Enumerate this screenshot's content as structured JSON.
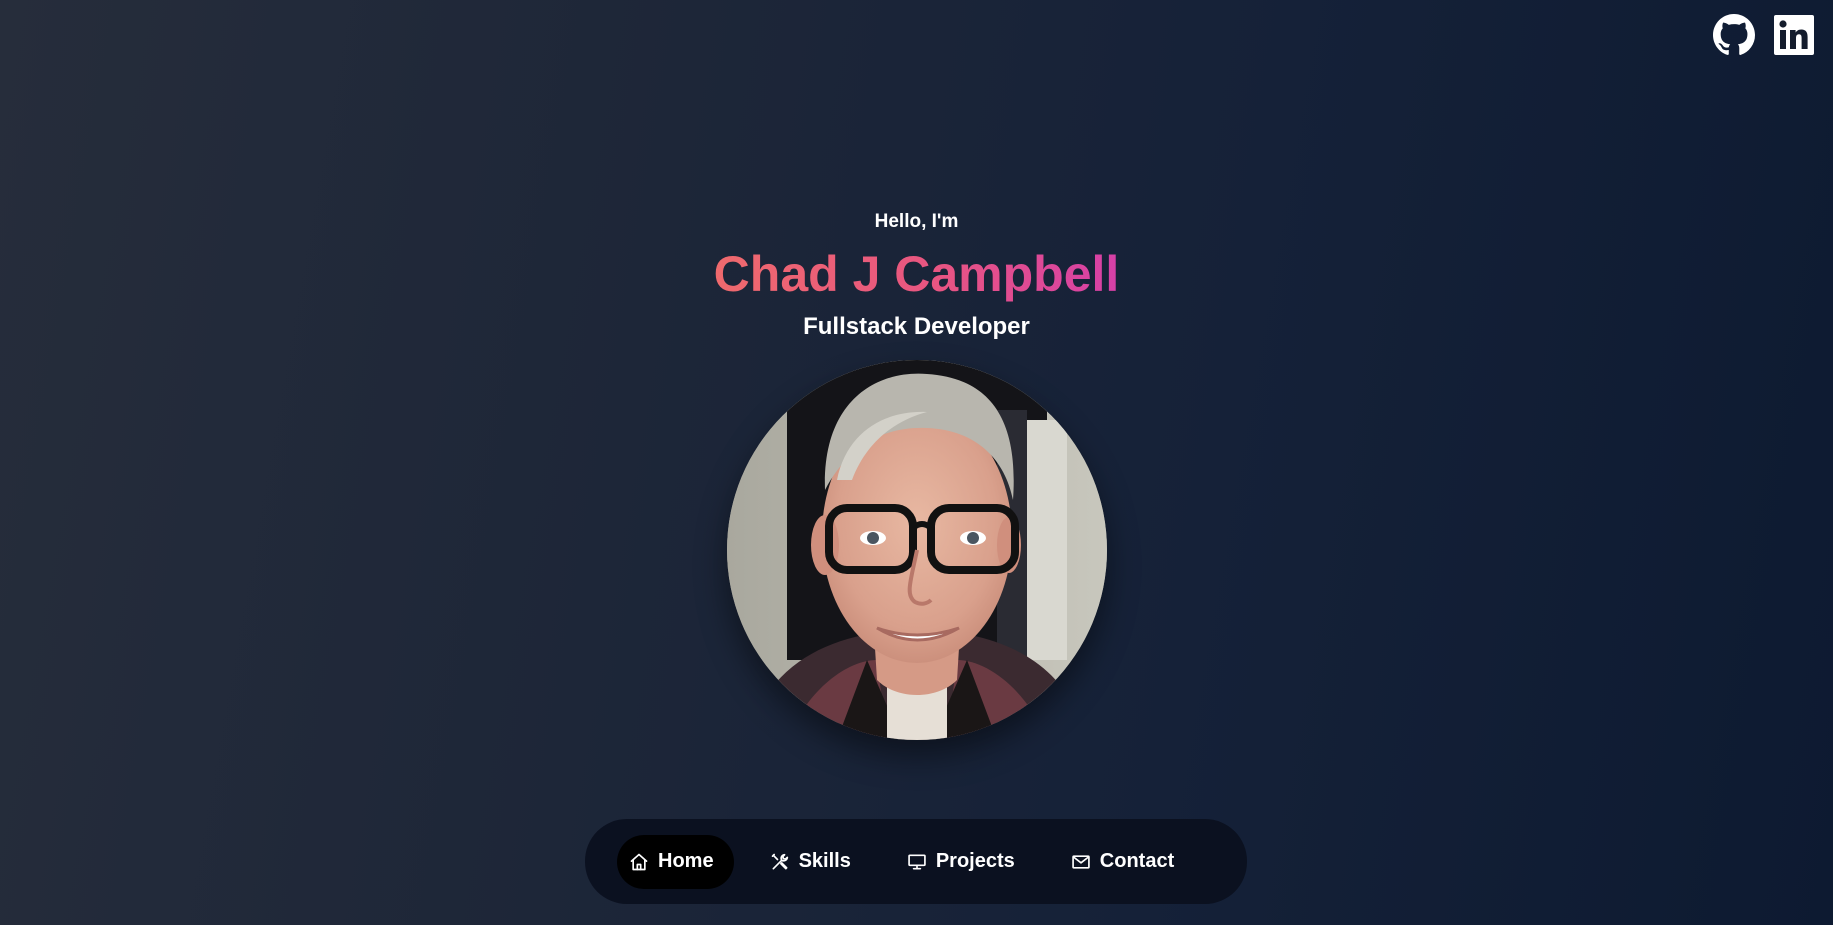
{
  "social": {
    "github_icon": "github-icon",
    "linkedin_icon": "linkedin-icon"
  },
  "hero": {
    "greeting": "Hello, I'm",
    "name": "Chad J Campbell",
    "role": "Fullstack Developer",
    "photo_alt": "profile-photo"
  },
  "nav": {
    "items": [
      {
        "label": "Home",
        "icon": "home-icon",
        "active": true
      },
      {
        "label": "Skills",
        "icon": "tools-icon",
        "active": false
      },
      {
        "label": "Projects",
        "icon": "monitor-icon",
        "active": false
      },
      {
        "label": "Contact",
        "icon": "mail-icon",
        "active": false
      }
    ]
  },
  "colors": {
    "name_gradient_start": "#ef6a6d",
    "name_gradient_end": "#d640a7",
    "nav_background": "#0b1120",
    "nav_active": "#000000"
  }
}
